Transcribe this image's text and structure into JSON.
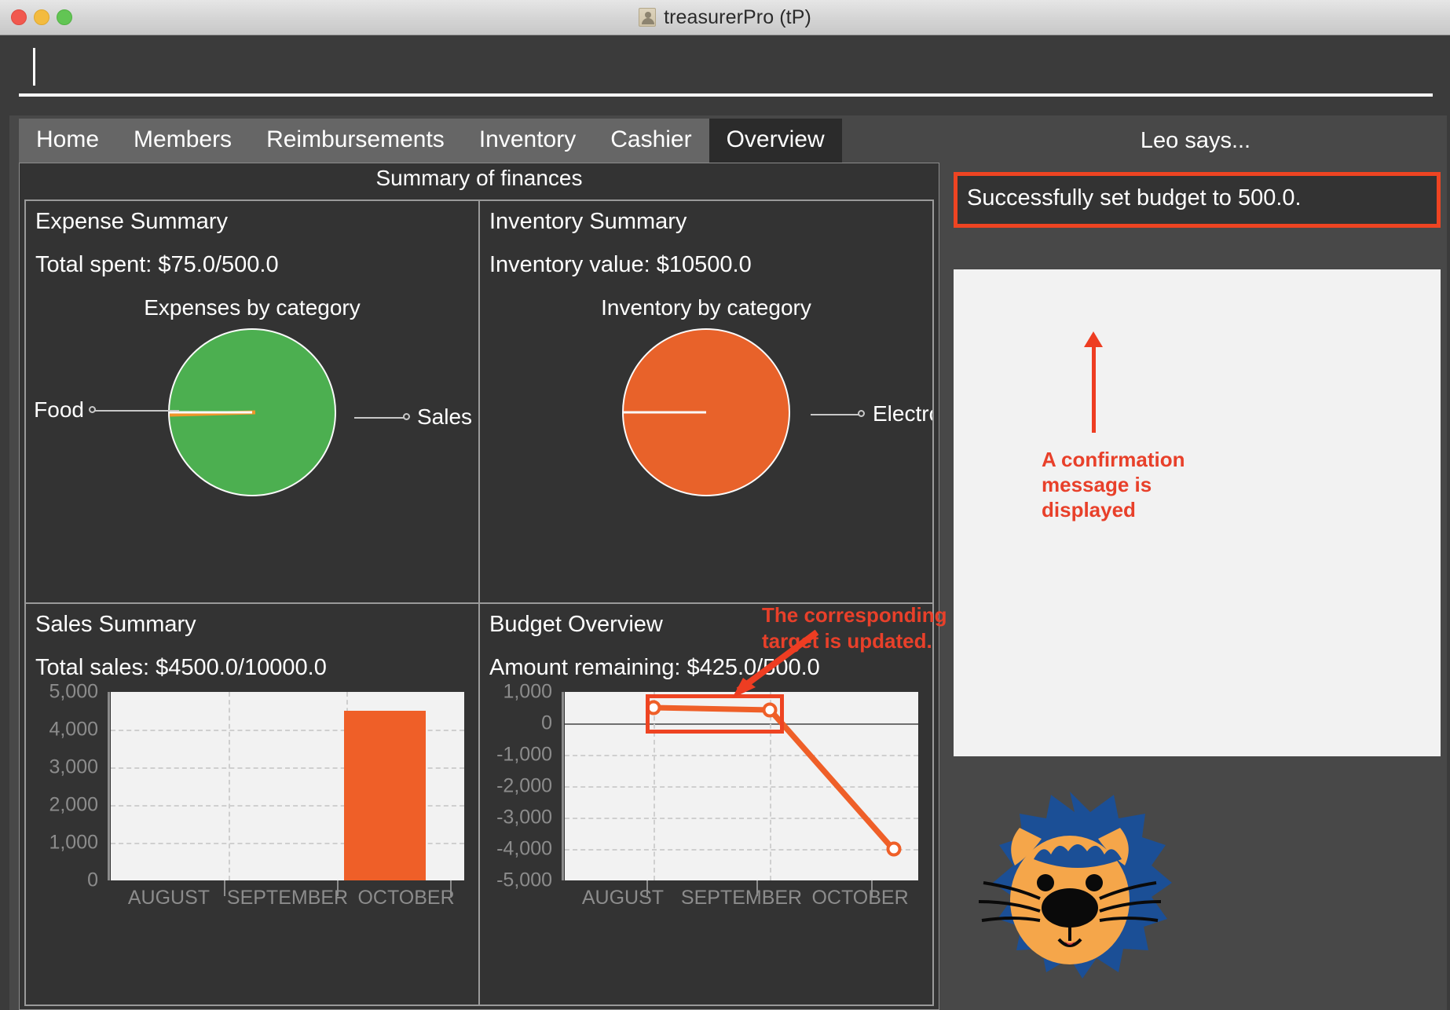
{
  "window": {
    "title": "treasurerPro (tP)",
    "icon": "person-icon",
    "traffic_lights": [
      "close",
      "minimize",
      "zoom"
    ]
  },
  "command_input": {
    "value": "",
    "placeholder": ""
  },
  "tabs": [
    {
      "label": "Home",
      "active": false
    },
    {
      "label": "Members",
      "active": false
    },
    {
      "label": "Reimbursements",
      "active": false
    },
    {
      "label": "Inventory",
      "active": false
    },
    {
      "label": "Cashier",
      "active": false
    },
    {
      "label": "Overview",
      "active": true
    }
  ],
  "main": {
    "caption": "Summary of finances",
    "panels": {
      "expense": {
        "title": "Expense Summary",
        "stat": "Total spent: $75.0/500.0",
        "chart_title": "Expenses by category",
        "label_left": "Food",
        "label_right": "Sales"
      },
      "inventory": {
        "title": "Inventory Summary",
        "stat": "Inventory value: $10500.0",
        "chart_title": "Inventory by category",
        "label_right": "Electronics"
      },
      "sales": {
        "title": "Sales Summary",
        "stat": "Total sales: $4500.0/10000.0"
      },
      "budget": {
        "title": "Budget Overview",
        "stat_label": "Amount remaining:",
        "stat_value": "$425.0/500.0"
      }
    }
  },
  "sidebar": {
    "heading": "Leo says...",
    "message": "Successfully set budget to 500.0.",
    "mascot": "lion-icon"
  },
  "annotations": [
    {
      "name": "confirmation-note",
      "text": "A confirmation\nmessage is\ndisplayed",
      "color": "#e8402a"
    },
    {
      "name": "target-note",
      "text": "The corresponding\ntarget is updated.",
      "color": "#e8402a"
    }
  ],
  "colors": {
    "accent_red": "#ee4422",
    "pie_green": "#4caf50",
    "pie_orange": "#e8622a",
    "bar_orange": "#ef5f28",
    "panel_bg": "#333333",
    "window_bg": "#484848"
  },
  "chart_data": [
    {
      "name": "expenses-by-category-pie",
      "type": "pie",
      "title": "Expenses by category",
      "categories": [
        "Sales",
        "Food"
      ],
      "values": [
        99.2,
        0.8
      ],
      "colors": [
        "#4caf50",
        "#f0962a"
      ],
      "labels": [
        "Sales",
        "Food"
      ],
      "legend": "leader-lines"
    },
    {
      "name": "inventory-by-category-pie",
      "type": "pie",
      "title": "Inventory by category",
      "categories": [
        "Electronics"
      ],
      "values": [
        100
      ],
      "colors": [
        "#e8622a"
      ],
      "labels": [
        "Electronics"
      ],
      "legend": "leader-lines"
    },
    {
      "name": "sales-summary-bar",
      "type": "bar",
      "title": "",
      "categories": [
        "AUGUST",
        "SEPTEMBER",
        "OCTOBER"
      ],
      "values": [
        0,
        0,
        4500
      ],
      "ylim": [
        0,
        5000
      ],
      "yticks": [
        0,
        1000,
        2000,
        3000,
        4000,
        5000
      ],
      "ytick_labels": [
        "0",
        "1,000",
        "2,000",
        "3,000",
        "4,000",
        "5,000"
      ],
      "xlabel": "",
      "ylabel": "",
      "grid": true,
      "color": "#ef5f28"
    },
    {
      "name": "budget-overview-line",
      "type": "line",
      "title": "",
      "categories": [
        "AUGUST",
        "SEPTEMBER",
        "OCTOBER"
      ],
      "values": [
        500,
        425,
        -4000
      ],
      "ylim": [
        -5000,
        1000
      ],
      "yticks": [
        -5000,
        -4000,
        -3000,
        -2000,
        -1000,
        0,
        1000
      ],
      "ytick_labels": [
        "-5,000",
        "-4,000",
        "-3,000",
        "-2,000",
        "-1,000",
        "0",
        "1,000"
      ],
      "xlabel": "",
      "ylabel": "",
      "grid": true,
      "color": "#ef5f28",
      "markers": true
    }
  ]
}
